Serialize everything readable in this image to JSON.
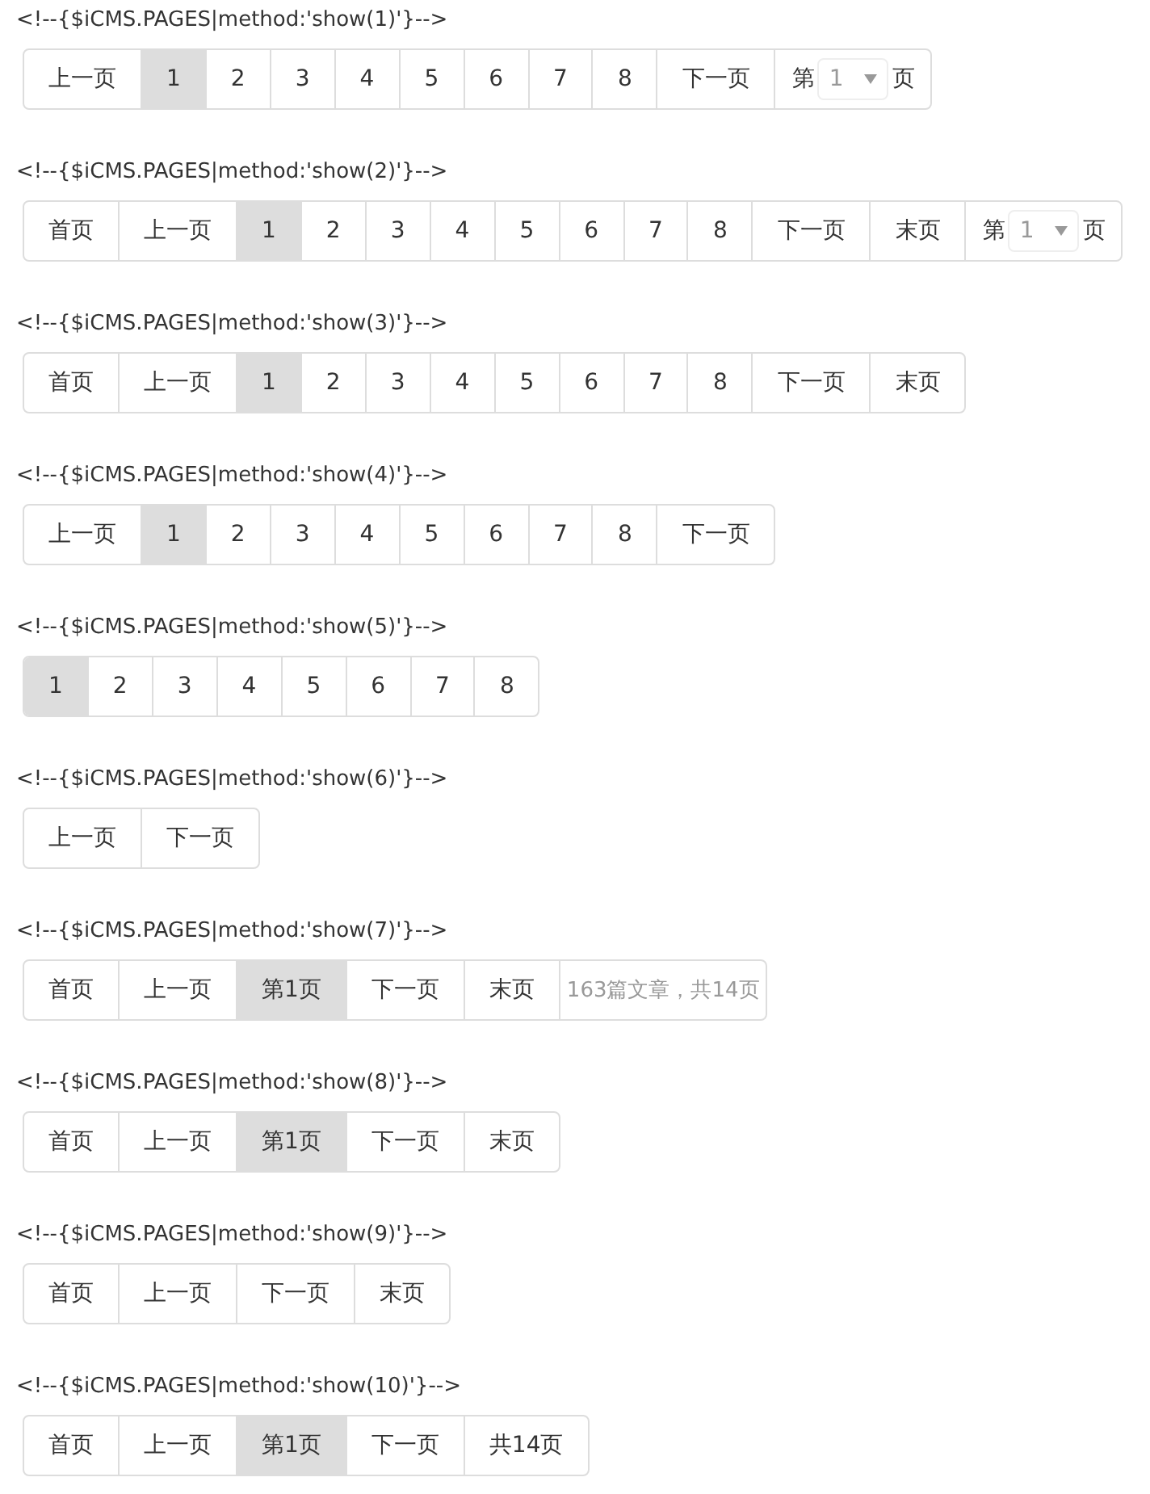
{
  "examples": [
    {
      "comment": "<!--{$iCMS.PAGES|method:'show(1)'}-->",
      "items": [
        {
          "kind": "link",
          "label": "上一页",
          "selected": false
        },
        {
          "kind": "link",
          "label": "1",
          "selected": true
        },
        {
          "kind": "link",
          "label": "2",
          "selected": false
        },
        {
          "kind": "link",
          "label": "3",
          "selected": false
        },
        {
          "kind": "link",
          "label": "4",
          "selected": false
        },
        {
          "kind": "link",
          "label": "5",
          "selected": false
        },
        {
          "kind": "link",
          "label": "6",
          "selected": false
        },
        {
          "kind": "link",
          "label": "7",
          "selected": false
        },
        {
          "kind": "link",
          "label": "8",
          "selected": false
        },
        {
          "kind": "link",
          "label": "下一页",
          "selected": false
        },
        {
          "kind": "select",
          "prefix": "第",
          "value": "1",
          "suffix": "页"
        }
      ]
    },
    {
      "comment": "<!--{$iCMS.PAGES|method:'show(2)'}-->",
      "items": [
        {
          "kind": "link",
          "label": "首页",
          "selected": false
        },
        {
          "kind": "link",
          "label": "上一页",
          "selected": false
        },
        {
          "kind": "link",
          "label": "1",
          "selected": true
        },
        {
          "kind": "link",
          "label": "2",
          "selected": false
        },
        {
          "kind": "link",
          "label": "3",
          "selected": false
        },
        {
          "kind": "link",
          "label": "4",
          "selected": false
        },
        {
          "kind": "link",
          "label": "5",
          "selected": false
        },
        {
          "kind": "link",
          "label": "6",
          "selected": false
        },
        {
          "kind": "link",
          "label": "7",
          "selected": false
        },
        {
          "kind": "link",
          "label": "8",
          "selected": false
        },
        {
          "kind": "link",
          "label": "下一页",
          "selected": false
        },
        {
          "kind": "link",
          "label": "末页",
          "selected": false
        },
        {
          "kind": "select",
          "prefix": "第",
          "value": "1",
          "suffix": "页"
        }
      ]
    },
    {
      "comment": "<!--{$iCMS.PAGES|method:'show(3)'}-->",
      "items": [
        {
          "kind": "link",
          "label": "首页",
          "selected": false
        },
        {
          "kind": "link",
          "label": "上一页",
          "selected": false
        },
        {
          "kind": "link",
          "label": "1",
          "selected": true
        },
        {
          "kind": "link",
          "label": "2",
          "selected": false
        },
        {
          "kind": "link",
          "label": "3",
          "selected": false
        },
        {
          "kind": "link",
          "label": "4",
          "selected": false
        },
        {
          "kind": "link",
          "label": "5",
          "selected": false
        },
        {
          "kind": "link",
          "label": "6",
          "selected": false
        },
        {
          "kind": "link",
          "label": "7",
          "selected": false
        },
        {
          "kind": "link",
          "label": "8",
          "selected": false
        },
        {
          "kind": "link",
          "label": "下一页",
          "selected": false
        },
        {
          "kind": "link",
          "label": "末页",
          "selected": false
        }
      ]
    },
    {
      "comment": "<!--{$iCMS.PAGES|method:'show(4)'}-->",
      "items": [
        {
          "kind": "link",
          "label": "上一页",
          "selected": false
        },
        {
          "kind": "link",
          "label": "1",
          "selected": true
        },
        {
          "kind": "link",
          "label": "2",
          "selected": false
        },
        {
          "kind": "link",
          "label": "3",
          "selected": false
        },
        {
          "kind": "link",
          "label": "4",
          "selected": false
        },
        {
          "kind": "link",
          "label": "5",
          "selected": false
        },
        {
          "kind": "link",
          "label": "6",
          "selected": false
        },
        {
          "kind": "link",
          "label": "7",
          "selected": false
        },
        {
          "kind": "link",
          "label": "8",
          "selected": false
        },
        {
          "kind": "link",
          "label": "下一页",
          "selected": false
        }
      ]
    },
    {
      "comment": "<!--{$iCMS.PAGES|method:'show(5)'}-->",
      "items": [
        {
          "kind": "link",
          "label": "1",
          "selected": true
        },
        {
          "kind": "link",
          "label": "2",
          "selected": false
        },
        {
          "kind": "link",
          "label": "3",
          "selected": false
        },
        {
          "kind": "link",
          "label": "4",
          "selected": false
        },
        {
          "kind": "link",
          "label": "5",
          "selected": false
        },
        {
          "kind": "link",
          "label": "6",
          "selected": false
        },
        {
          "kind": "link",
          "label": "7",
          "selected": false
        },
        {
          "kind": "link",
          "label": "8",
          "selected": false
        }
      ]
    },
    {
      "comment": "<!--{$iCMS.PAGES|method:'show(6)'}-->",
      "items": [
        {
          "kind": "link",
          "label": "上一页",
          "selected": false
        },
        {
          "kind": "link",
          "label": "下一页",
          "selected": false
        }
      ]
    },
    {
      "comment": "<!--{$iCMS.PAGES|method:'show(7)'}-->",
      "items": [
        {
          "kind": "link",
          "label": "首页",
          "selected": false
        },
        {
          "kind": "link",
          "label": "上一页",
          "selected": false
        },
        {
          "kind": "link",
          "label": "第1页",
          "selected": true
        },
        {
          "kind": "link",
          "label": "下一页",
          "selected": false
        },
        {
          "kind": "link",
          "label": "末页",
          "selected": false
        },
        {
          "kind": "info",
          "label": "163篇文章，共14页"
        }
      ]
    },
    {
      "comment": "<!--{$iCMS.PAGES|method:'show(8)'}-->",
      "items": [
        {
          "kind": "link",
          "label": "首页",
          "selected": false
        },
        {
          "kind": "link",
          "label": "上一页",
          "selected": false
        },
        {
          "kind": "link",
          "label": "第1页",
          "selected": true
        },
        {
          "kind": "link",
          "label": "下一页",
          "selected": false
        },
        {
          "kind": "link",
          "label": "末页",
          "selected": false
        }
      ]
    },
    {
      "comment": "<!--{$iCMS.PAGES|method:'show(9)'}-->",
      "items": [
        {
          "kind": "link",
          "label": "首页",
          "selected": false
        },
        {
          "kind": "link",
          "label": "上一页",
          "selected": false
        },
        {
          "kind": "link",
          "label": "下一页",
          "selected": false
        },
        {
          "kind": "link",
          "label": "末页",
          "selected": false
        }
      ]
    },
    {
      "comment": "<!--{$iCMS.PAGES|method:'show(10)'}-->",
      "items": [
        {
          "kind": "link",
          "label": "首页",
          "selected": false
        },
        {
          "kind": "link",
          "label": "上一页",
          "selected": false
        },
        {
          "kind": "link",
          "label": "第1页",
          "selected": true
        },
        {
          "kind": "link",
          "label": "下一页",
          "selected": false
        },
        {
          "kind": "link",
          "label": "共14页",
          "selected": false
        }
      ]
    }
  ]
}
